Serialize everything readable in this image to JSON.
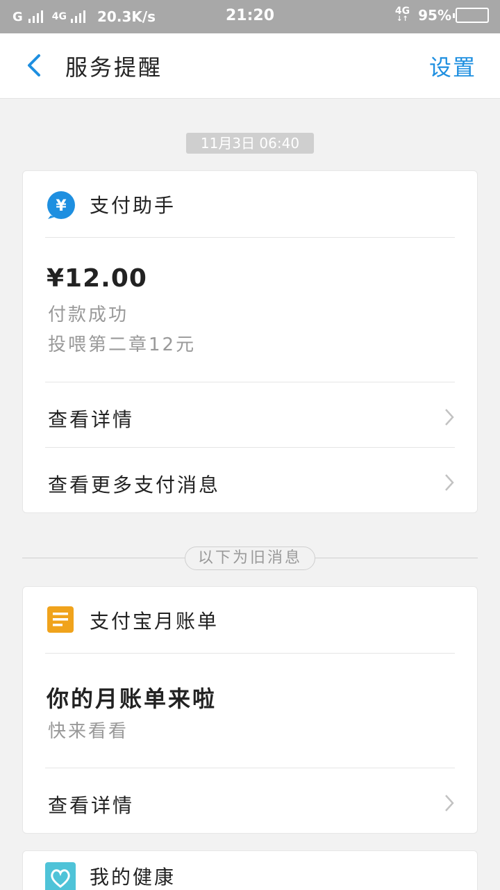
{
  "status_bar": {
    "carrier1": "G",
    "carrier2": "4G",
    "speed": "20.3K/s",
    "time": "21:20",
    "network": "4G",
    "battery": "95%",
    "battery_level": 0.95
  },
  "header": {
    "title": "服务提醒",
    "settings_label": "设置"
  },
  "timestamp": "11月3日 06:40",
  "payment_card": {
    "sender": "支付助手",
    "icon_color": "#1e8fe0",
    "amount": "¥12.00",
    "status": "付款成功",
    "description": "投喂第二章12元",
    "actions": [
      "查看详情",
      "查看更多支付消息"
    ]
  },
  "old_messages_label": "以下为旧消息",
  "bill_card": {
    "sender": "支付宝月账单",
    "icon_color": "#f0a31c",
    "title": "你的月账单来啦",
    "subtitle": "快来看看",
    "action": "查看详情"
  },
  "health_card": {
    "sender": "我的健康",
    "icon_color": "#4fc3d8"
  }
}
